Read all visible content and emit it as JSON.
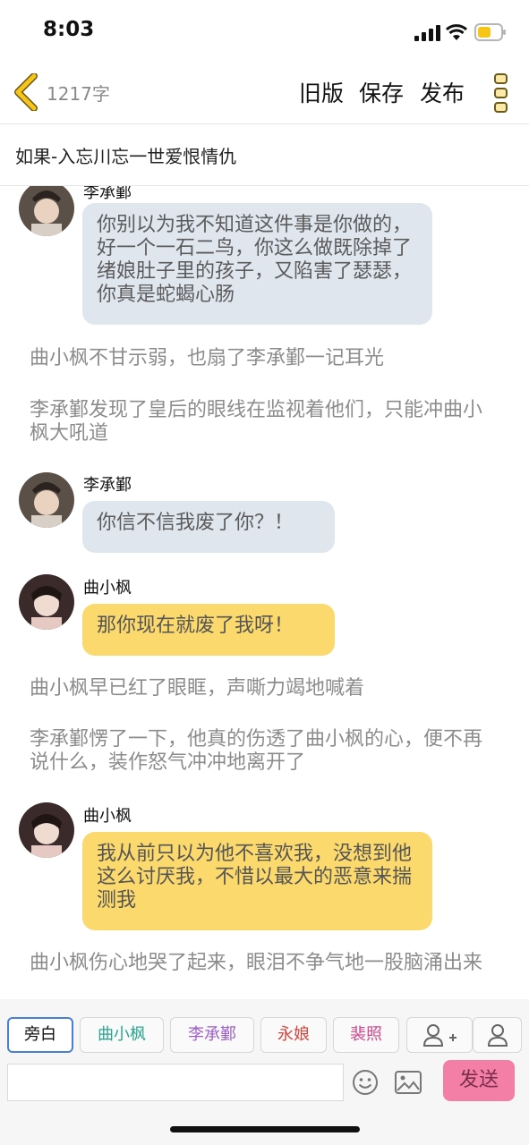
{
  "status_bar": {
    "time": "8:03"
  },
  "nav": {
    "word_count": "1217字",
    "old_version": "旧版",
    "save": "保存",
    "publish": "发布",
    "accent_color": "#f5c518"
  },
  "story_title": "如果-入忘川忘一世爱恨情仇",
  "messages": [
    {
      "type": "dialogue",
      "speaker": "李承鄞",
      "style": "blue",
      "text": "你别以为我不知道这件事是你做的，好一个一石二鸟，你这么做既除掉了绪娘肚子里的孩子，又陷害了瑟瑟，你真是蛇蝎心肠"
    },
    {
      "type": "narration",
      "text": "曲小枫不甘示弱，也扇了李承鄞一记耳光"
    },
    {
      "type": "narration",
      "text": "李承鄞发现了皇后的眼线在监视着他们，只能冲曲小枫大吼道"
    },
    {
      "type": "dialogue",
      "speaker": "李承鄞",
      "style": "blue",
      "text": "你信不信我废了你？！"
    },
    {
      "type": "dialogue",
      "speaker": "曲小枫",
      "style": "yellow",
      "text": "那你现在就废了我呀！"
    },
    {
      "type": "narration",
      "text": "曲小枫早已红了眼眶，声嘶力竭地喊着"
    },
    {
      "type": "narration",
      "text": "李承鄞愣了一下，他真的伤透了曲小枫的心，便不再说什么，装作怒气冲冲地离开了"
    },
    {
      "type": "dialogue",
      "speaker": "曲小枫",
      "style": "yellow",
      "text": "我从前只以为他不喜欢我，没想到他这么讨厌我，不惜以最大的恶意来揣测我"
    },
    {
      "type": "narration",
      "text": "曲小枫伤心地哭了起来，眼泪不争气地一股脑涌出来"
    }
  ],
  "roles": [
    {
      "label": "旁白",
      "color": "#111111",
      "active": true
    },
    {
      "label": "曲小枫",
      "color": "#2aa58f",
      "active": false
    },
    {
      "label": "李承鄞",
      "color": "#9b5fc8",
      "active": false
    },
    {
      "label": "永娘",
      "color": "#d2473f",
      "active": false
    },
    {
      "label": "裴照",
      "color": "#d0488a",
      "active": false
    }
  ],
  "input": {
    "value": ""
  },
  "send_label": "发送",
  "colors": {
    "bubble_blue": "#dfe6ee",
    "bubble_yellow": "#fbd96c",
    "send_bg": "#f47fa6"
  }
}
